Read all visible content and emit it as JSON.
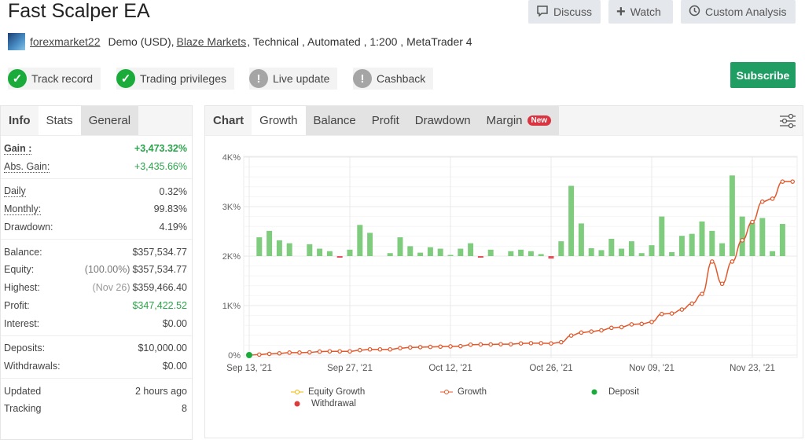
{
  "header": {
    "title": "Fast Scalper EA",
    "discuss": "Discuss",
    "watch": "Watch",
    "custom_analysis": "Custom Analysis",
    "subscribe": "Subscribe"
  },
  "meta": {
    "user": "forexmarket22",
    "account": "Demo (USD),",
    "broker": "Blaze Markets",
    "details": ", Technical , Automated , 1:200 , MetaTrader 4"
  },
  "badges": [
    {
      "label": "Track record",
      "status": "ok"
    },
    {
      "label": "Trading privileges",
      "status": "ok"
    },
    {
      "label": "Live update",
      "status": "warning"
    },
    {
      "label": "Cashback",
      "status": "warning"
    }
  ],
  "left_tabs": [
    "Info",
    "Stats",
    "General"
  ],
  "stats": {
    "gain": {
      "label": "Gain :",
      "value": "+3,473.32%"
    },
    "abs_gain": {
      "label": "Abs. Gain:",
      "value": "+3,435.66%"
    },
    "daily": {
      "label": "Daily",
      "value": "0.32%"
    },
    "monthly": {
      "label": "Monthly:",
      "value": "99.83%"
    },
    "drawdown": {
      "label": "Drawdown:",
      "value": "4.19%"
    },
    "balance": {
      "label": "Balance:",
      "value": "$357,534.77"
    },
    "equity": {
      "label": "Equity:",
      "note": "(100.00%)",
      "value": "$357,534.77"
    },
    "highest": {
      "label": "Highest:",
      "note": "(Nov 26)",
      "value": "$359,466.40"
    },
    "profit": {
      "label": "Profit:",
      "value": "$347,422.52"
    },
    "interest": {
      "label": "Interest:",
      "value": "$0.00"
    },
    "deposits": {
      "label": "Deposits:",
      "value": "$10,000.00"
    },
    "withdrawals": {
      "label": "Withdrawals:",
      "value": "$0.00"
    },
    "updated": {
      "label": "Updated",
      "value": "2 hours ago"
    },
    "tracking": {
      "label": "Tracking",
      "value": "8"
    }
  },
  "chart_tabs": {
    "title": "Chart",
    "tabs": [
      "Growth",
      "Balance",
      "Profit",
      "Drawdown",
      "Margin"
    ],
    "active": "Growth",
    "new_badge": "New"
  },
  "colors": {
    "growth": "#e0582b",
    "equity": "#f0b400",
    "deposit": "#1aab3b",
    "withdrawal": "#e03a3a",
    "bars_positive": "#7fcc7f",
    "bars_negative": "#e8505b",
    "brand": "#1f9d63"
  },
  "chart_data": {
    "type": "line",
    "y_ticks": [
      "0%",
      "1K%",
      "2K%",
      "3K%",
      "4K%"
    ],
    "ylim": [
      0,
      4000
    ],
    "x_tick_labels": [
      "Sep 13, '21",
      "Sep 27, '21",
      "Oct 12, '21",
      "Oct 26, '21",
      "Nov 09, '21",
      "Nov 23, '21"
    ],
    "grid": true,
    "legend": [
      "Equity Growth",
      "Growth",
      "Deposit",
      "Withdrawal"
    ],
    "legend_position": "bottom",
    "growth": [
      0,
      10,
      25,
      35,
      50,
      50,
      55,
      70,
      75,
      75,
      75,
      100,
      115,
      115,
      115,
      140,
      155,
      160,
      165,
      170,
      175,
      180,
      210,
      215,
      215,
      220,
      220,
      235,
      240,
      240,
      235,
      260,
      395,
      455,
      475,
      500,
      550,
      565,
      620,
      630,
      670,
      830,
      840,
      920,
      1040,
      1235,
      1890,
      1440,
      1890,
      2320,
      2690,
      3100,
      3160,
      3505,
      3505
    ],
    "daily_bars_note": "",
    "daily_bars": [
      0,
      0.38,
      0.51,
      0.32,
      0.26,
      0,
      0.24,
      0.15,
      0.1,
      -0.01,
      0.13,
      0.63,
      0.47,
      0,
      0.06,
      0.38,
      0.2,
      0.07,
      0.18,
      0.15,
      0.01,
      0.15,
      0.26,
      -0.01,
      0.13,
      0,
      0.1,
      0.13,
      0.1,
      0.04,
      -0.05,
      0.3,
      1.42,
      0.66,
      0.16,
      0.12,
      0.35,
      0.15,
      0.3,
      0.06,
      0.22,
      0.8,
      0.08,
      0.41,
      0.45,
      0.7,
      0.51,
      0.26,
      1.63,
      0.8,
      0.68,
      0.77,
      0.1,
      0.65,
      0
    ],
    "deposit_points": [
      0
    ]
  }
}
